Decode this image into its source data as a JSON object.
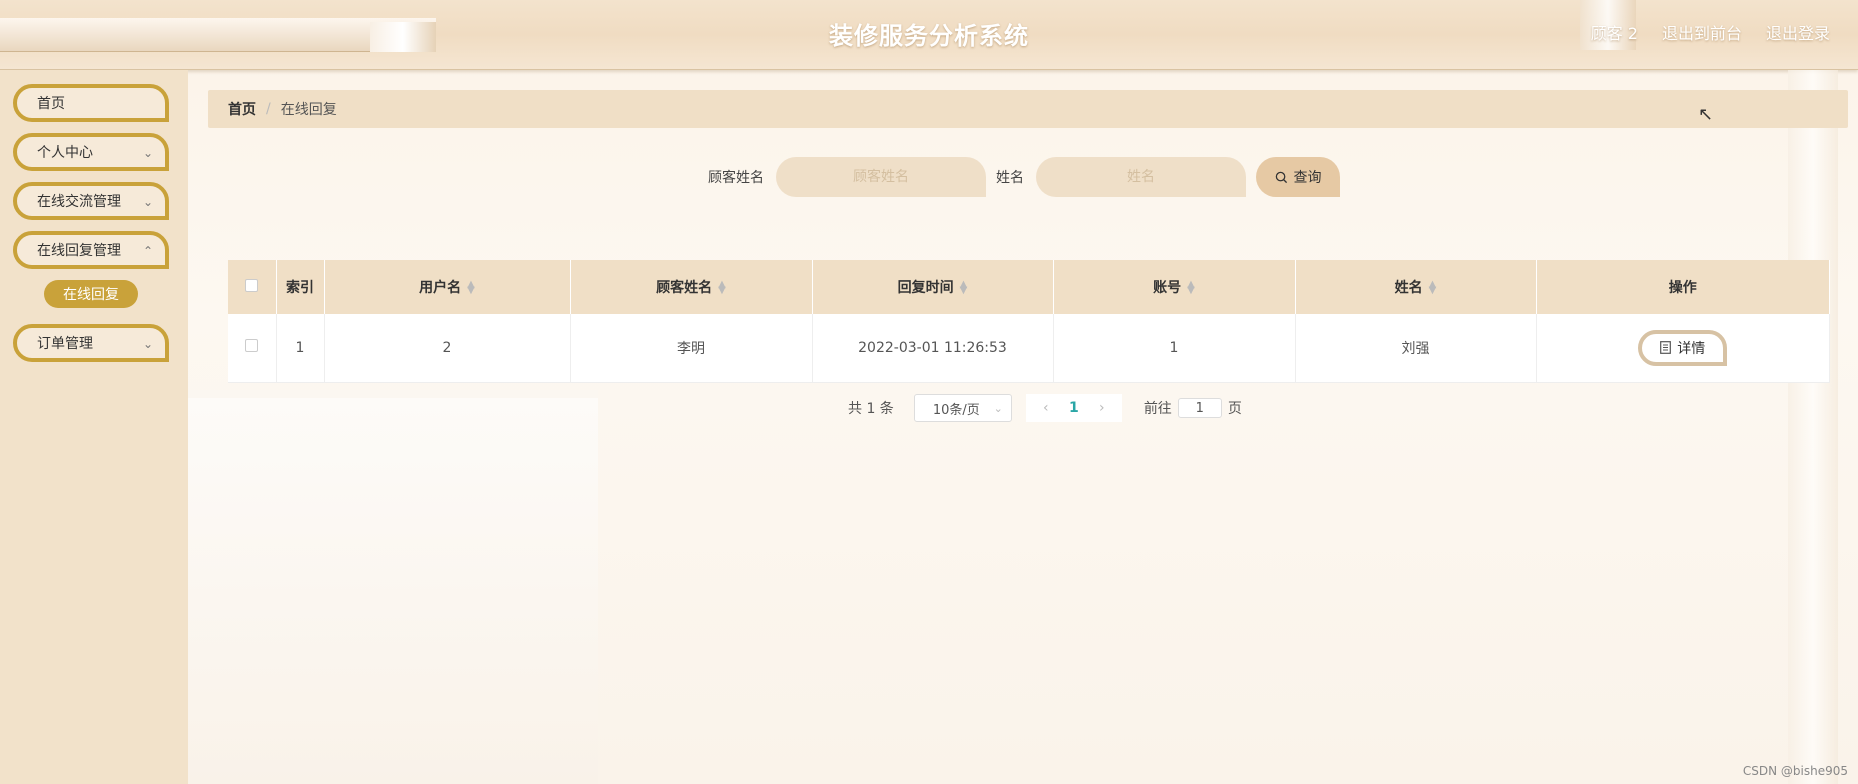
{
  "header": {
    "title": "装修服务分析系统",
    "user": "顾客 2",
    "back_to_front": "退出到前台",
    "logout": "退出登录"
  },
  "sidebar": {
    "items": [
      {
        "label": "首页"
      },
      {
        "label": "个人中心"
      },
      {
        "label": "在线交流管理"
      },
      {
        "label": "在线回复管理"
      },
      {
        "label": "订单管理"
      }
    ],
    "sub_active": "在线回复"
  },
  "breadcrumb": {
    "home": "首页",
    "separator": "/",
    "current": "在线回复"
  },
  "search": {
    "customer_name_label": "顾客姓名",
    "customer_name_placeholder": "顾客姓名",
    "name_label": "姓名",
    "name_placeholder": "姓名",
    "query_label": "查询"
  },
  "table": {
    "headers": [
      "索引",
      "用户名",
      "顾客姓名",
      "回复时间",
      "账号",
      "姓名",
      "操作"
    ],
    "rows": [
      {
        "index": "1",
        "username": "2",
        "customer_name": "李明",
        "reply_time": "2022-03-01 11:26:53",
        "account": "1",
        "name": "刘强",
        "action": "详情"
      }
    ]
  },
  "pagination": {
    "total": "共 1 条",
    "page_size": "10条/页",
    "current_page": "1",
    "goto_label": "前往",
    "goto_value": "1",
    "page_suffix": "页"
  },
  "watermark": "CSDN @bishe905",
  "colors": {
    "accent": "#c9a23a",
    "header_bg": "#f0dcc2",
    "sidebar_bg": "#f2e2ca"
  }
}
